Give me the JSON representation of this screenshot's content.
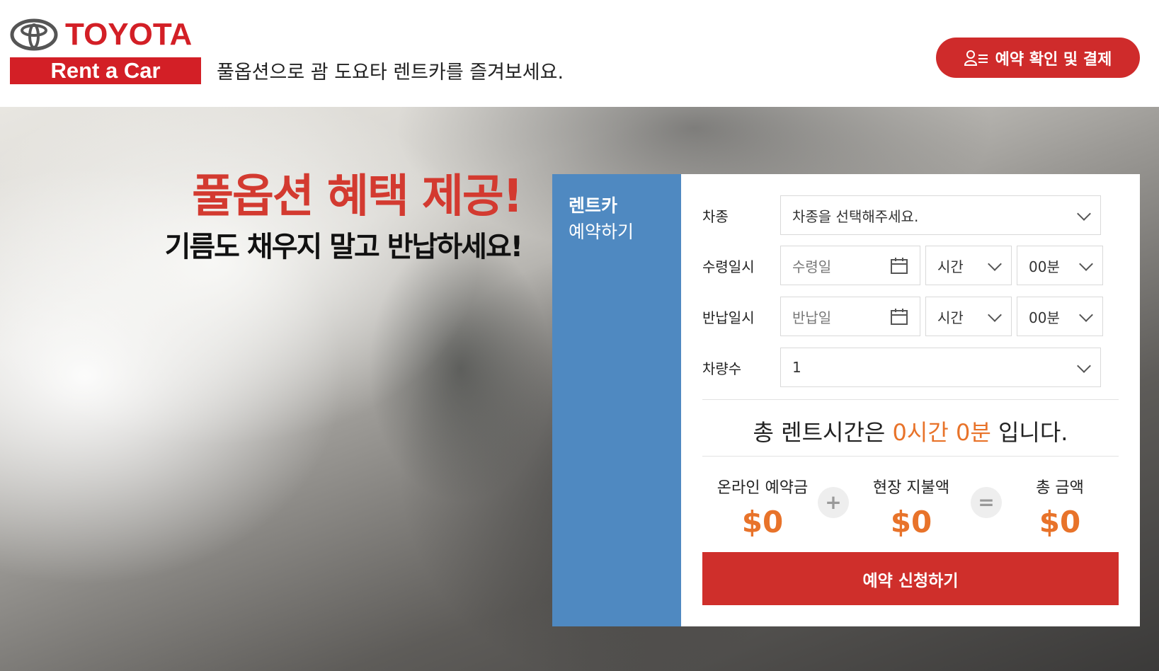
{
  "header": {
    "brand": "TOYOTA",
    "brand_sub": "Rent a Car",
    "tagline": "풀옵션으로 괌 도요타 렌트카를 즐겨보세요.",
    "confirm_button": "예약 확인 및 결제"
  },
  "hero": {
    "promo_title": "풀옵션 혜택 제공!",
    "promo_sub": "기름도 채우지 말고 반납하세요!"
  },
  "panel": {
    "title_line1": "렌트카",
    "title_line2": "예약하기",
    "car_label": "차종",
    "car_placeholder": "차종을 선택해주세요.",
    "pickup_label": "수령일시",
    "pickup_date_placeholder": "수령일",
    "pickup_hour": "시간",
    "pickup_min": "00분",
    "return_label": "반납일시",
    "return_date_placeholder": "반납일",
    "return_hour": "시간",
    "return_min": "00분",
    "count_label": "차량수",
    "count_value": "1",
    "total_prefix": "총 렌트시간은",
    "total_hours": "0시간",
    "total_minutes": "0분",
    "total_suffix": "입니다.",
    "online_label": "온라인 예약금",
    "online_value": "$0",
    "plus": "+",
    "onsite_label": "현장 지불액",
    "onsite_value": "$0",
    "equals": "=",
    "total_label": "총 금액",
    "total_value": "$0",
    "submit": "예약 신청하기"
  },
  "colors": {
    "brand_red": "#d31f26",
    "button_red": "#cf2f2b",
    "panel_blue": "#4f89c1",
    "accent_orange": "#e8732a"
  },
  "icons": [
    "toyota-emblem-icon",
    "user-list-icon",
    "calendar-icon",
    "chevron-down-icon"
  ]
}
